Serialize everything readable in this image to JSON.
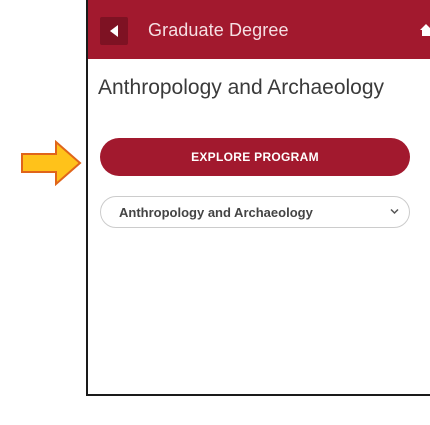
{
  "header": {
    "back_icon": "caret-left-icon",
    "title": "Graduate Degree",
    "home_icon": "home-icon"
  },
  "program": {
    "title": "Anthropology and Archaeology",
    "explore_label": "EXPLORE PROGRAM"
  },
  "program_select": {
    "selected": "Anthropology and Archaeology",
    "chevron_icon": "chevron-down-icon"
  },
  "annotation": {
    "pointer_icon": "arrow-right-icon"
  },
  "colors": {
    "brand": "#a2192e",
    "brand_dark": "#7e1223",
    "pointer_fill": "#ffc21a",
    "pointer_stroke": "#e0651a"
  }
}
